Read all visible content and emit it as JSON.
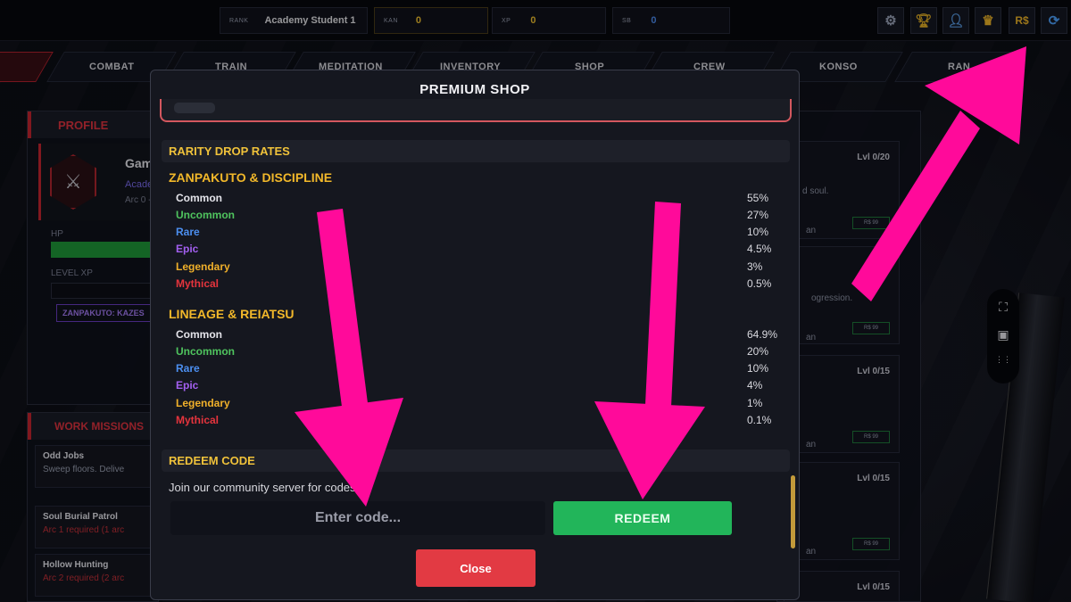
{
  "topbar": {
    "rank_label": "RANK",
    "rank_value": "Academy Student 1",
    "kan_label": "KAN",
    "kan_value": "0",
    "xp_label": "XP",
    "xp_value": "0",
    "sb_label": "SB",
    "sb_value": "0",
    "icons": [
      "gear-icon",
      "trophy-icon",
      "friends-icon",
      "crown-icon",
      "premium-currency-icon",
      "refresh-icon"
    ],
    "rs_text": "R$"
  },
  "nav": {
    "tabs": [
      "COMBAT",
      "TRAIN",
      "MEDITATION",
      "INVENTORY",
      "SHOP",
      "CREW",
      "KONSO",
      "RAN"
    ]
  },
  "profile": {
    "title": "PROFILE",
    "name_partial": "Gam",
    "class_partial": "Acade",
    "arc_partial": "Arc 0 -",
    "hp_label": "HP",
    "level_xp_label": "LEVEL XP",
    "zanpakuto_tag": "ZANPAKUTO: KAZES"
  },
  "work_missions": {
    "title": "WORK MISSIONS",
    "items": [
      {
        "title": "Odd Jobs",
        "subtitle": "Sweep floors. Delive"
      },
      {
        "title": "Soul Burial Patrol",
        "subtitle": "Arc 1 required (1 arc"
      },
      {
        "title": "Hollow Hunting",
        "subtitle": "Arc 2 required (2 arc"
      }
    ]
  },
  "shop_cards": {
    "levels": [
      "Lvl 0/20",
      "Lvl 0/15",
      "Lvl 0/15",
      "Lvl 0/15"
    ],
    "desc_1": "d soul.",
    "desc_2": "ogression.",
    "price": "R$ 99",
    "tag": "an"
  },
  "modal": {
    "title": "PREMIUM SHOP",
    "rarity_header": "RARITY DROP RATES",
    "groups": [
      {
        "title": "ZANPAKUTO & DISCIPLINE",
        "rows": [
          {
            "name": "Common",
            "pct": "55%",
            "color": "#e4e4ea"
          },
          {
            "name": "Uncommon",
            "pct": "27%",
            "color": "#4fc45e"
          },
          {
            "name": "Rare",
            "pct": "10%",
            "color": "#4c8ff0"
          },
          {
            "name": "Epic",
            "pct": "4.5%",
            "color": "#a35ff0"
          },
          {
            "name": "Legendary",
            "pct": "3%",
            "color": "#f0b02a"
          },
          {
            "name": "Mythical",
            "pct": "0.5%",
            "color": "#e5343d"
          }
        ]
      },
      {
        "title": "LINEAGE & REIATSU",
        "rows": [
          {
            "name": "Common",
            "pct": "64.9%",
            "color": "#e4e4ea"
          },
          {
            "name": "Uncommon",
            "pct": "20%",
            "color": "#4fc45e"
          },
          {
            "name": "Rare",
            "pct": "10%",
            "color": "#4c8ff0"
          },
          {
            "name": "Epic",
            "pct": "4%",
            "color": "#a35ff0"
          },
          {
            "name": "Legendary",
            "pct": "1%",
            "color": "#f0b02a"
          },
          {
            "name": "Mythical",
            "pct": "0.1%",
            "color": "#e5343d"
          }
        ]
      }
    ],
    "redeem_header": "REDEEM CODE",
    "redeem_text": "Join our community server for codes!",
    "code_placeholder": "Enter code...",
    "redeem_button": "REDEEM",
    "close_button": "Close"
  },
  "annotation_color": "#ff0a9a"
}
